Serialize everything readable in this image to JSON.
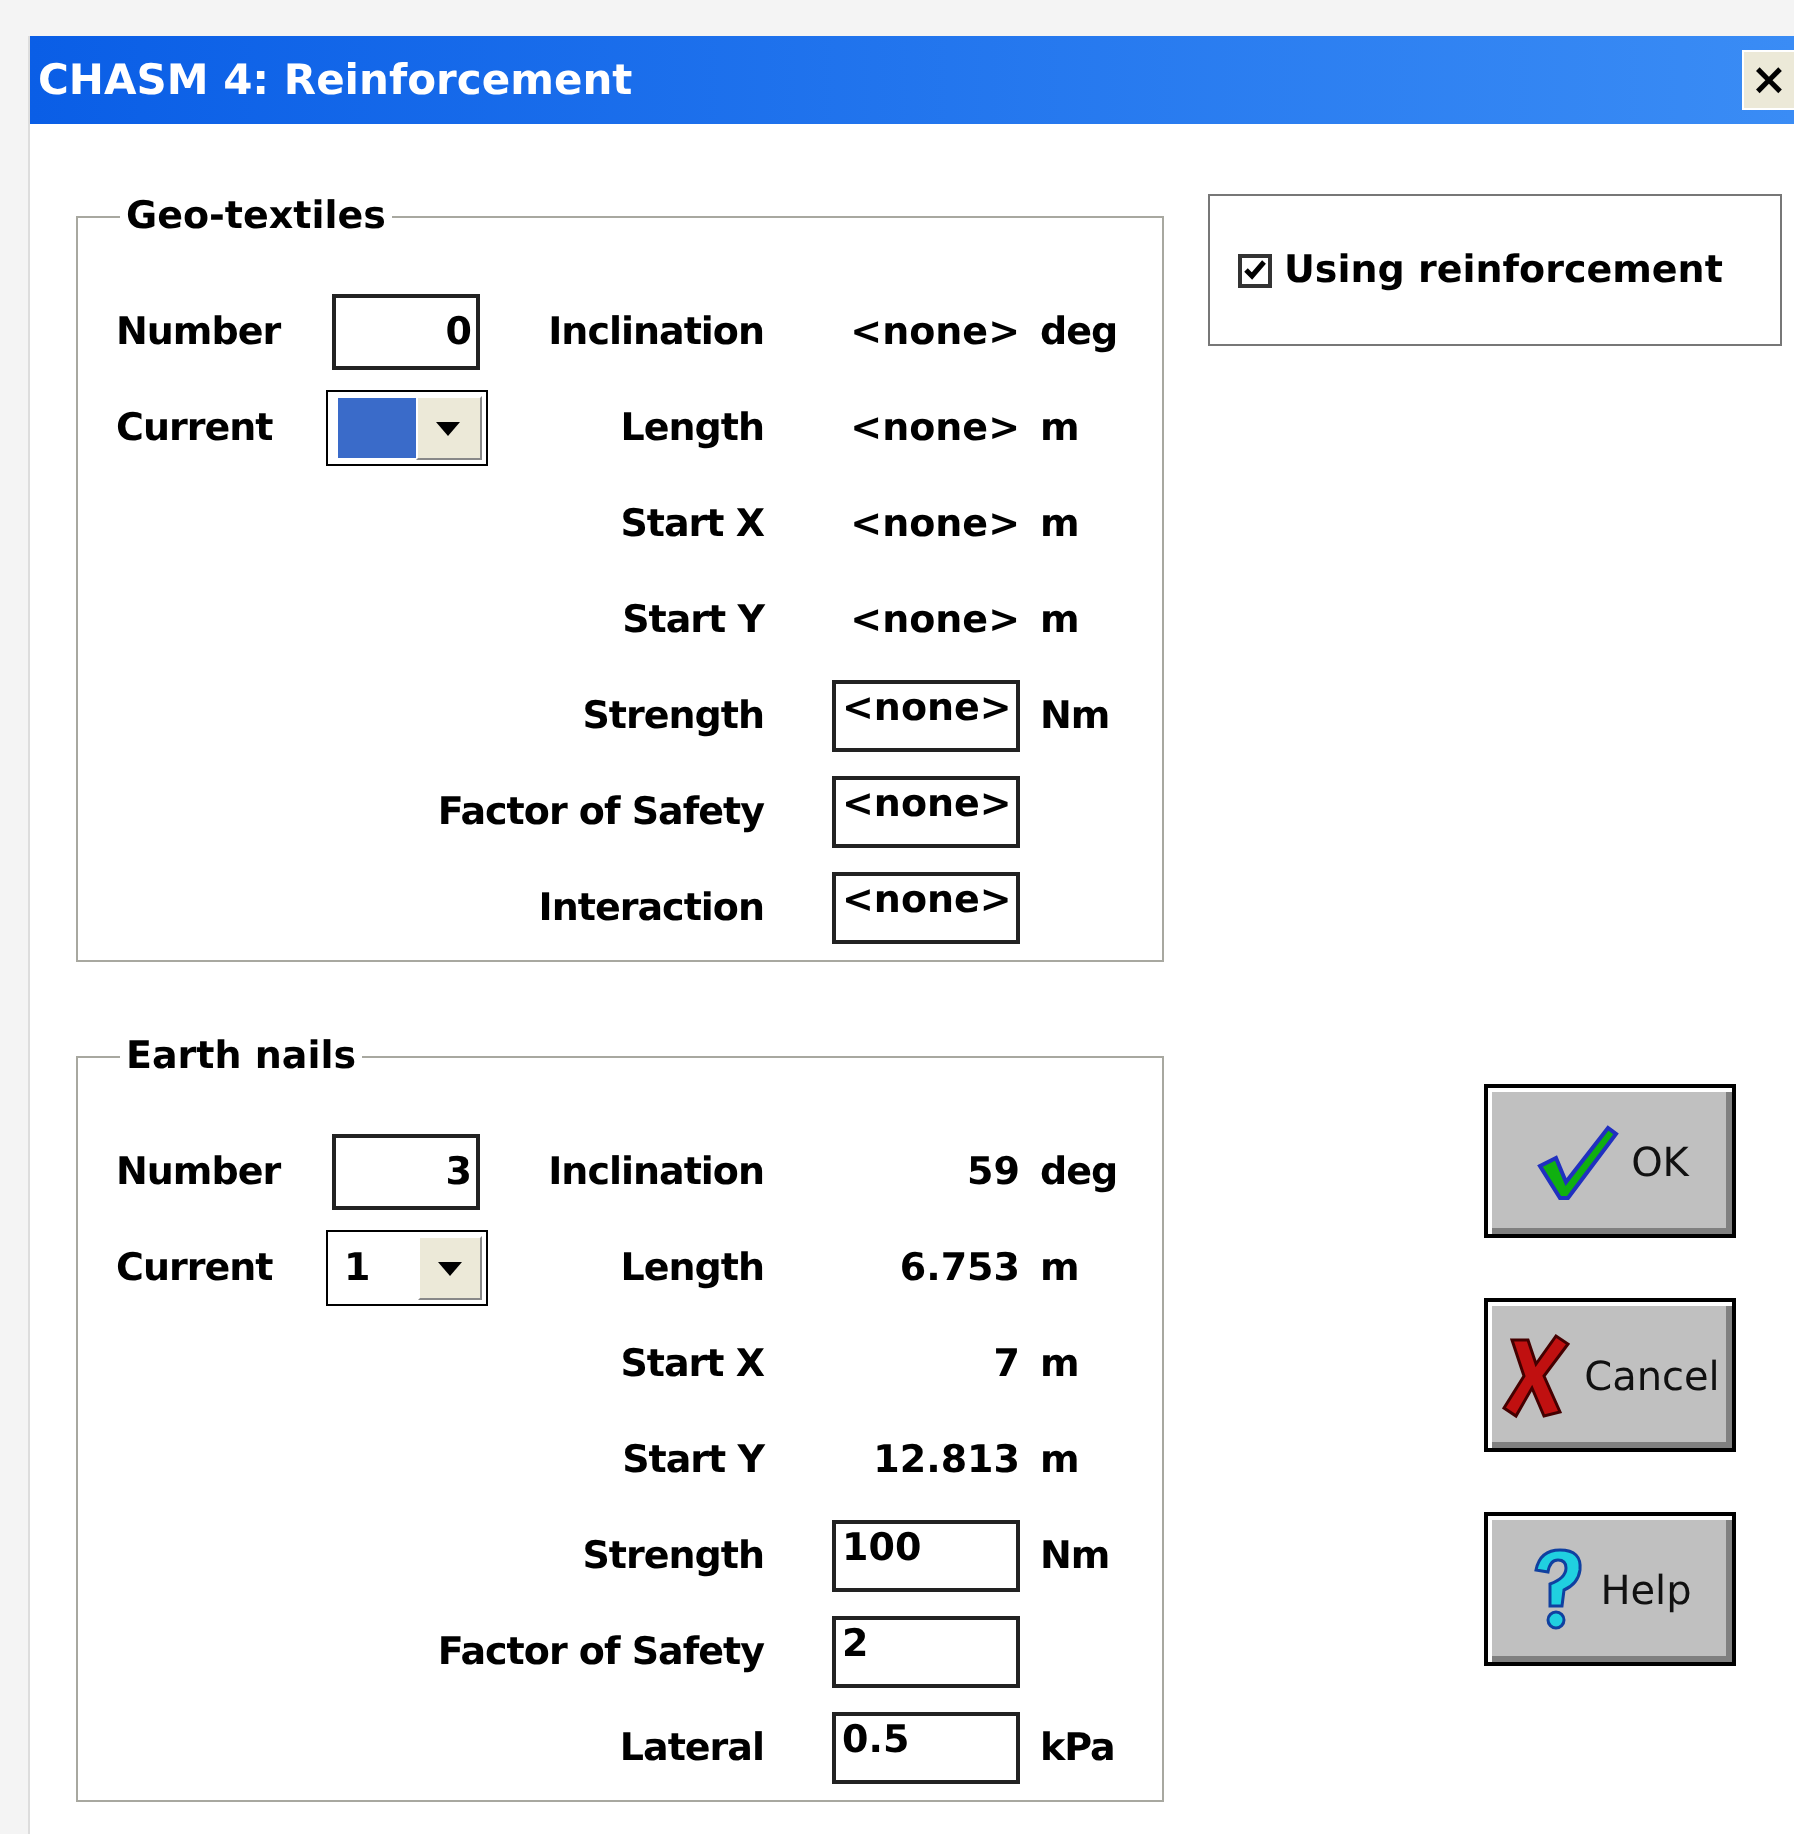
{
  "window": {
    "title": "CHASM 4: Reinforcement",
    "close": "×"
  },
  "groups": [
    {
      "title": "Geo-textiles",
      "number_label": "Number",
      "number": "0",
      "current_label": "Current",
      "current": {
        "kind": "swatch",
        "color": "#3a6bc9"
      },
      "fields": [
        {
          "label": "Inclination",
          "kind": "readout",
          "value": "<none>",
          "unit": "deg"
        },
        {
          "label": "Length",
          "kind": "readout",
          "value": "<none>",
          "unit": "m"
        },
        {
          "label": "Start X",
          "kind": "readout",
          "value": "<none>",
          "unit": "m"
        },
        {
          "label": "Start Y",
          "kind": "readout",
          "value": "<none>",
          "unit": "m"
        },
        {
          "label": "Strength",
          "kind": "input",
          "value": "<none>",
          "unit": "Nm"
        },
        {
          "label": "Factor of Safety",
          "kind": "input",
          "value": "<none>"
        },
        {
          "label": "Interaction",
          "kind": "input",
          "value": "<none>"
        }
      ]
    },
    {
      "title": "Earth nails",
      "number_label": "Number",
      "number": "3",
      "current_label": "Current",
      "current": {
        "kind": "text",
        "value": "1"
      },
      "fields": [
        {
          "label": "Inclination",
          "kind": "readout",
          "value": "59",
          "unit": "deg"
        },
        {
          "label": "Length",
          "kind": "readout",
          "value": "6.753",
          "unit": "m"
        },
        {
          "label": "Start X",
          "kind": "readout",
          "value": "7",
          "unit": "m"
        },
        {
          "label": "Start Y",
          "kind": "readout",
          "value": "12.813",
          "unit": "m"
        },
        {
          "label": "Strength",
          "kind": "input",
          "value": "100",
          "unit": "Nm"
        },
        {
          "label": "Factor of Safety",
          "kind": "input",
          "value": "2"
        },
        {
          "label": "Lateral",
          "kind": "input",
          "value": "0.5",
          "unit": "kPa"
        }
      ]
    }
  ],
  "using_reinforcement": {
    "label": "Using reinforcement",
    "checked": true
  },
  "buttons": [
    {
      "kind": "ok",
      "label": "OK"
    },
    {
      "kind": "cancel",
      "label": "Cancel"
    },
    {
      "kind": "help",
      "label": "Help"
    }
  ]
}
